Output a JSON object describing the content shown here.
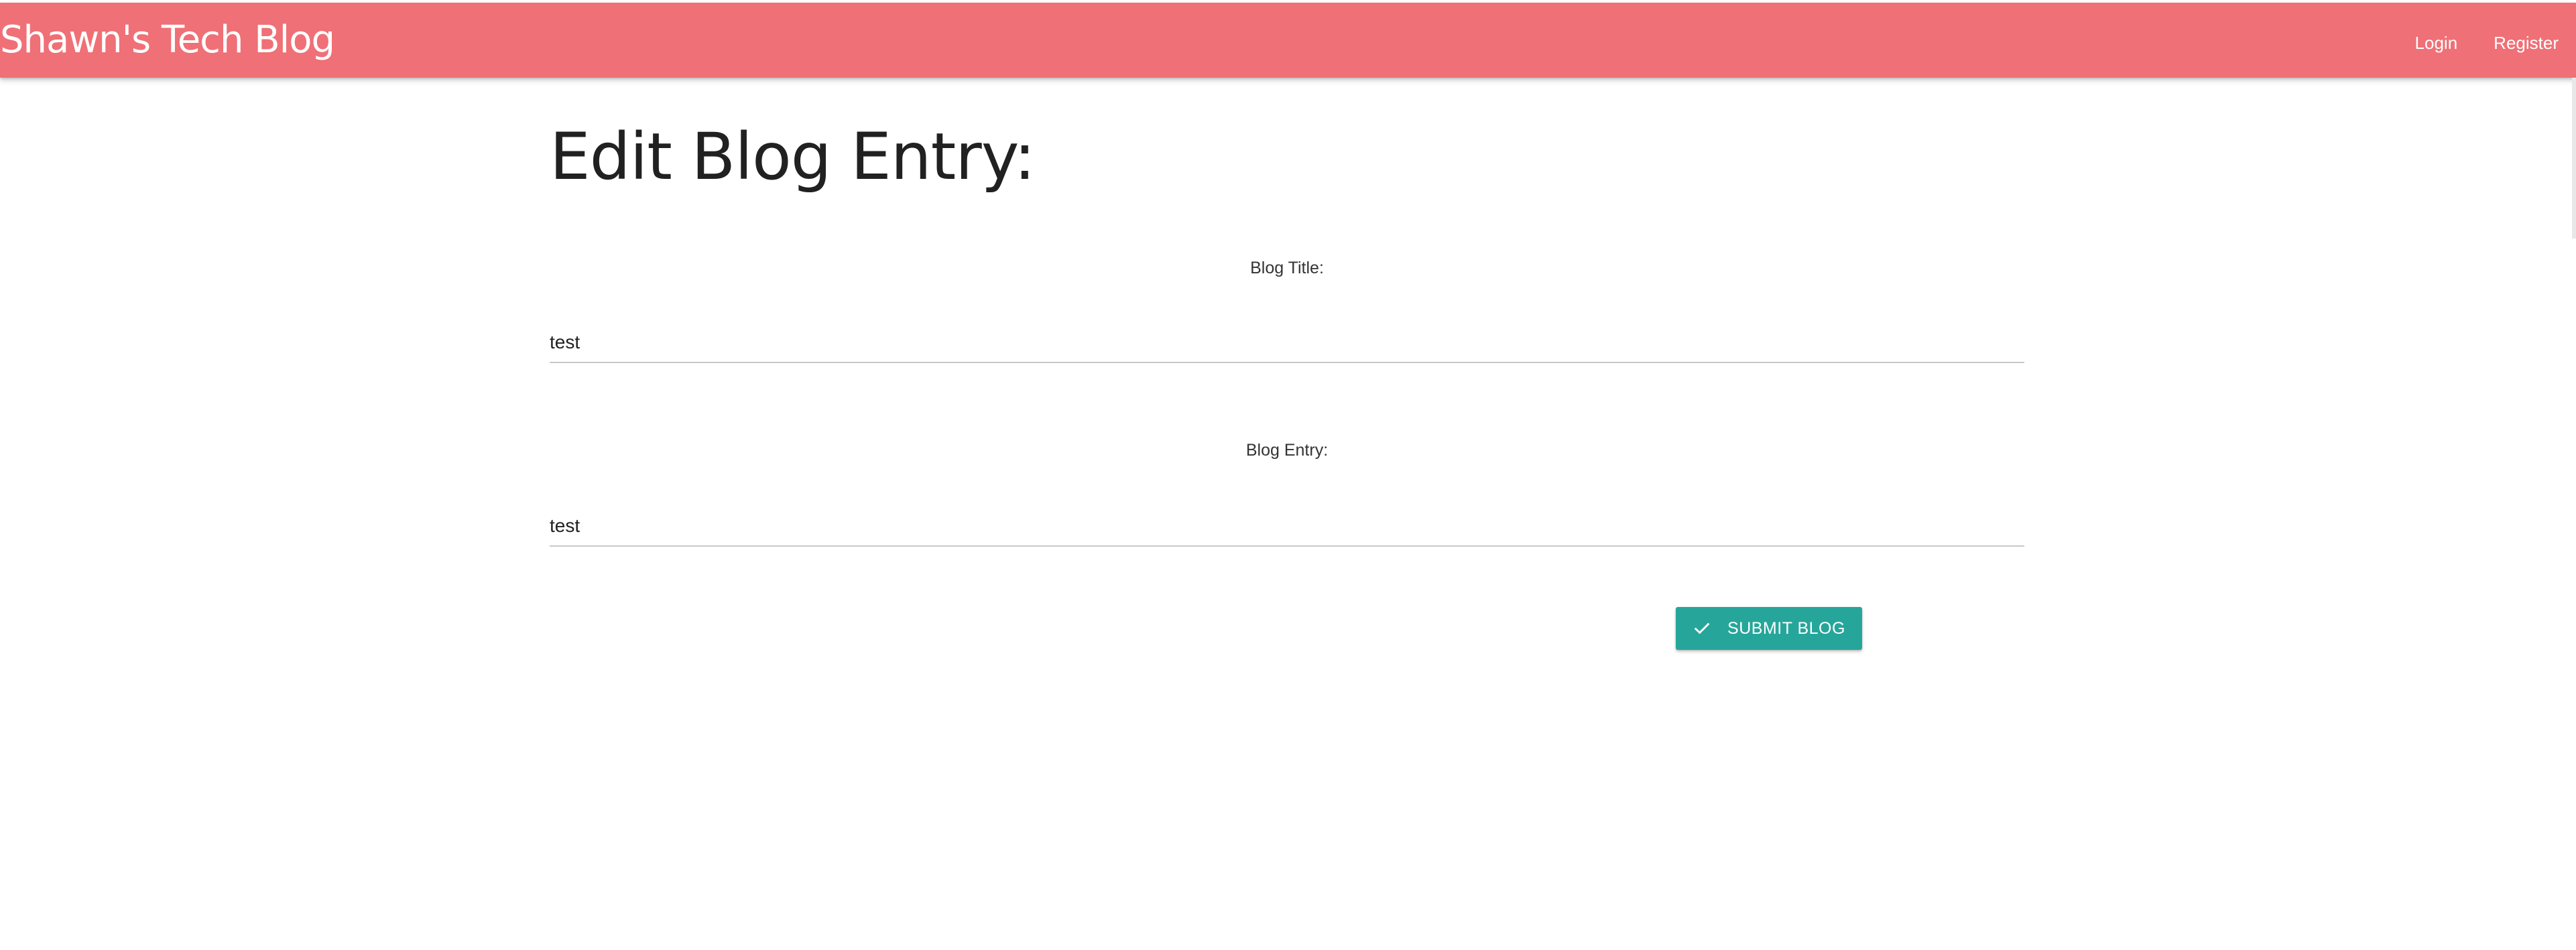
{
  "navbar": {
    "brand": "Shawn's Tech Blog",
    "links": [
      "Login",
      "Register"
    ],
    "color": "#ef7076"
  },
  "page": {
    "heading": "Edit Blog Entry:"
  },
  "form": {
    "title_label": "Blog Title:",
    "title_value": "test",
    "entry_label": "Blog Entry:",
    "entry_value": "test",
    "submit_label": "SUBMIT BLOG",
    "submit_icon": "check-icon",
    "submit_color": "#26a69a"
  }
}
